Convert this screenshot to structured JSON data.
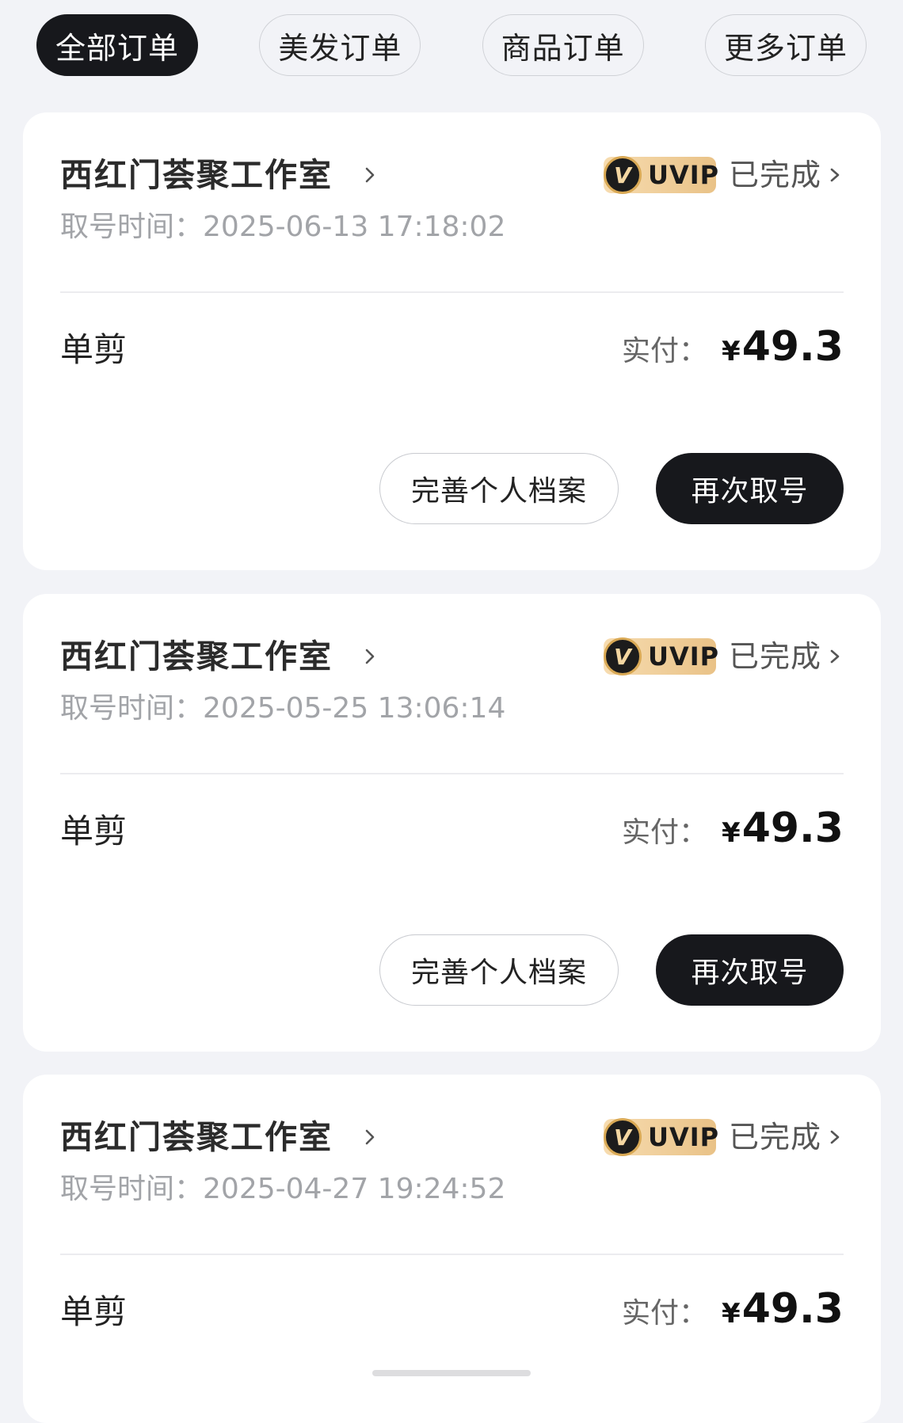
{
  "tabs": [
    {
      "label": "全部订单",
      "active": true
    },
    {
      "label": "美发订单",
      "active": false
    },
    {
      "label": "商品订单",
      "active": false
    },
    {
      "label": "更多订单",
      "active": false
    }
  ],
  "orders": [
    {
      "shop": "西红门荟聚工作室",
      "vip_label": "UVIP",
      "vip_coin": "V",
      "status": "已完成",
      "time_label": "取号时间：",
      "time": "2025-06-13 17:18:02",
      "service": "单剪",
      "pay_label": "实付：",
      "currency": "¥",
      "amount": "49.3",
      "btn_profile": "完善个人档案",
      "btn_again": "再次取号"
    },
    {
      "shop": "西红门荟聚工作室",
      "vip_label": "UVIP",
      "vip_coin": "V",
      "status": "已完成",
      "time_label": "取号时间：",
      "time": "2025-05-25 13:06:14",
      "service": "单剪",
      "pay_label": "实付：",
      "currency": "¥",
      "amount": "49.3",
      "btn_profile": "完善个人档案",
      "btn_again": "再次取号"
    },
    {
      "shop": "西红门荟聚工作室",
      "vip_label": "UVIP",
      "vip_coin": "V",
      "status": "已完成",
      "time_label": "取号时间：",
      "time": "2025-04-27 19:24:52",
      "service": "单剪",
      "pay_label": "实付：",
      "currency": "¥",
      "amount": "49.3"
    }
  ],
  "colors": {
    "background": "#f2f3f7",
    "active_tab": "#17181c",
    "vip_gold": "#e9c287"
  }
}
